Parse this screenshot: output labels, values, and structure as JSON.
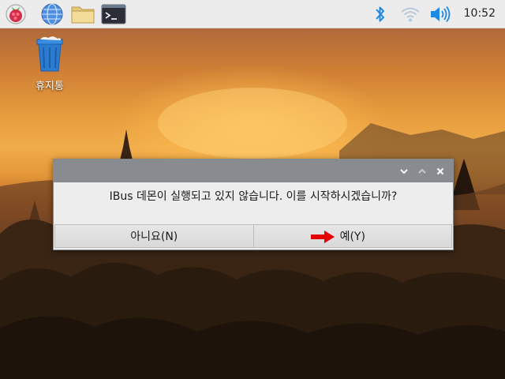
{
  "taskbar": {
    "launchers": [
      {
        "name": "raspberry-menu",
        "icon": "raspberry-icon"
      },
      {
        "name": "web-browser",
        "icon": "globe-icon"
      },
      {
        "name": "file-manager",
        "icon": "folder-icon"
      },
      {
        "name": "terminal",
        "icon": "terminal-icon"
      }
    ],
    "tray": [
      {
        "name": "bluetooth",
        "icon": "bluetooth-icon"
      },
      {
        "name": "wifi",
        "icon": "wifi-icon"
      },
      {
        "name": "volume",
        "icon": "volume-icon"
      }
    ],
    "clock": "10:52"
  },
  "desktop": {
    "trash_label": "휴지통"
  },
  "dialog": {
    "message": "IBus 데몬이 실행되고 있지 않습니다. 이를 시작하시겠습니까?",
    "no_label": "아니요(N)",
    "yes_label": "예(Y)"
  },
  "colors": {
    "accent_blue": "#1e88e5",
    "arrow_red": "#e30000",
    "titlebar": "#888b90"
  }
}
